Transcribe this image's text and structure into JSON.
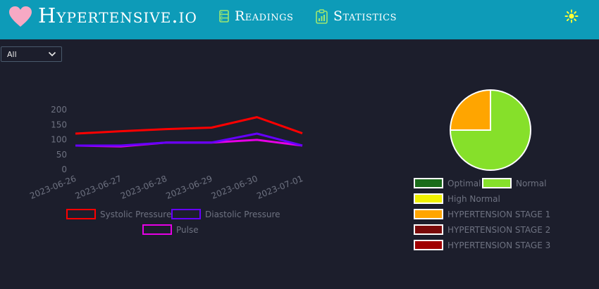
{
  "header": {
    "brand": "Hypertensive.io",
    "nav": [
      {
        "label": "Readings",
        "icon": "list-icon"
      },
      {
        "label": "Statistics",
        "icon": "clipboard-chart-icon"
      }
    ],
    "theme_icon": "sun-icon",
    "bar_color": "#0d9bb8",
    "logo_color": "#f7a9c4"
  },
  "filter": {
    "selected": "All"
  },
  "chart_data": [
    {
      "type": "line",
      "x": [
        "2023-06-26",
        "2023-06-27",
        "2023-06-28",
        "2023-06-29",
        "2023-06-30",
        "2023-07-01"
      ],
      "y_ticks": [
        "200",
        "150",
        "100",
        "50",
        "0"
      ],
      "ylim": [
        0,
        200
      ],
      "series": [
        {
          "name": "Systolic Pressure",
          "color": "#ff0000",
          "values": [
            120,
            128,
            135,
            140,
            175,
            121
          ]
        },
        {
          "name": "Diastolic Pressure",
          "color": "#6600ff",
          "values": [
            80,
            80,
            90,
            90,
            120,
            80
          ]
        },
        {
          "name": "Pulse",
          "color": "#e600e6",
          "values": [
            80,
            77,
            90,
            90,
            99,
            80
          ]
        }
      ],
      "legend_position": "bottom"
    },
    {
      "type": "pie",
      "slices": [
        {
          "label": "Optimal",
          "color": "#1a6b1a",
          "value": 0
        },
        {
          "label": "Normal",
          "color": "#86e02a",
          "value": 75
        },
        {
          "label": "High Normal",
          "color": "#f0f000",
          "value": 0
        },
        {
          "label": "HYPERTENSION STAGE 1",
          "color": "#ffa500",
          "value": 25
        },
        {
          "label": "HYPERTENSION STAGE 2",
          "color": "#7a0a0a",
          "value": 0
        },
        {
          "label": "HYPERTENSION STAGE 3",
          "color": "#a00000",
          "value": 0
        }
      ],
      "legend_position": "bottom"
    }
  ]
}
